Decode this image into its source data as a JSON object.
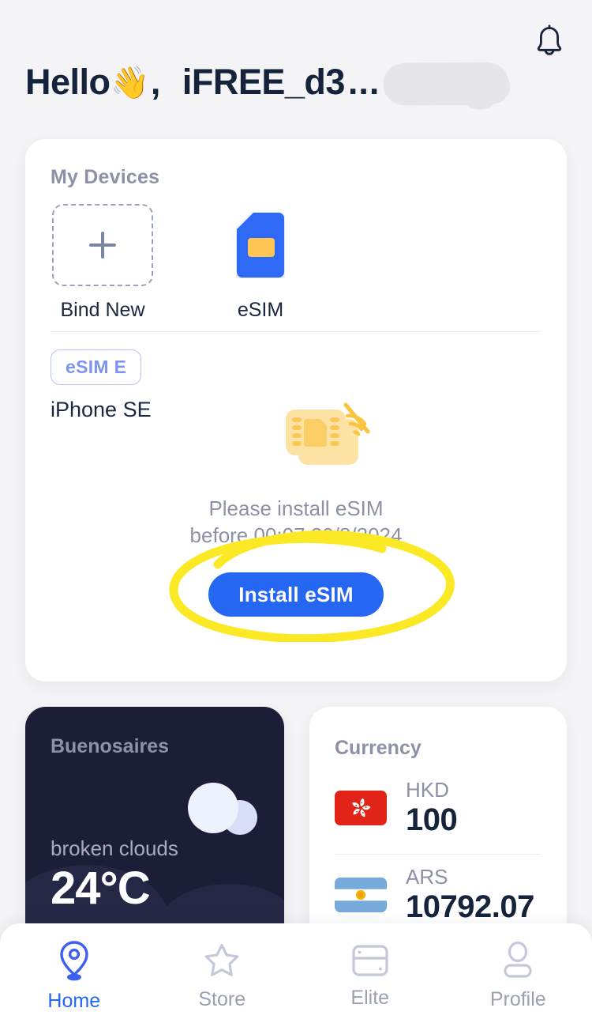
{
  "theme": {
    "background": "#f4f4f6",
    "card_background": "#ffffff",
    "accent_blue": "#2566f2",
    "muted_text": "#8b92a6",
    "dark_text": "#15233b",
    "weather_card_bg": "#1c1e38",
    "annotation_yellow": "#fbe926",
    "sim_yellow": "#fcd472",
    "badge_border": "#b9c6f2"
  },
  "header": {
    "greeting": "Hello",
    "wave_emoji": "👋",
    "comma": ",",
    "username": "iFREE_d3",
    "username_truncated_suffix": "...",
    "redacted": true,
    "notification_icon": "bell-icon"
  },
  "devices": {
    "title": "My Devices",
    "tiles": [
      {
        "icon": "plus-icon",
        "label": "Bind New"
      },
      {
        "icon": "sim-card-icon",
        "label": "eSIM"
      }
    ],
    "badge": "eSIM E",
    "device_name": "iPhone SE",
    "illustration_icon": "esim-no-signal-icon",
    "install_note_line1": "Please install eSIM",
    "install_note_line2": "before 00:07 20/8/2024",
    "install_button": "Install eSIM"
  },
  "annotation": {
    "shape": "hand-drawn-ellipse",
    "color": "#fbe926",
    "target": "install-esim-button"
  },
  "weather": {
    "city": "Buenosaires",
    "description": "broken clouds",
    "temperature": "24°C",
    "icon": "cloud-icon"
  },
  "currency": {
    "title": "Currency",
    "rows": [
      {
        "flag": "hong-kong-flag",
        "code": "HKD",
        "value": "100"
      },
      {
        "flag": "argentina-flag",
        "code": "ARS",
        "value": "10792.07"
      }
    ]
  },
  "bottom_nav": {
    "items": [
      {
        "icon": "location-pin-icon",
        "label": "Home",
        "active": true
      },
      {
        "icon": "star-icon",
        "label": "Store",
        "active": false
      },
      {
        "icon": "card-icon",
        "label": "Elite",
        "active": false
      },
      {
        "icon": "person-icon",
        "label": "Profile",
        "active": false
      }
    ]
  }
}
